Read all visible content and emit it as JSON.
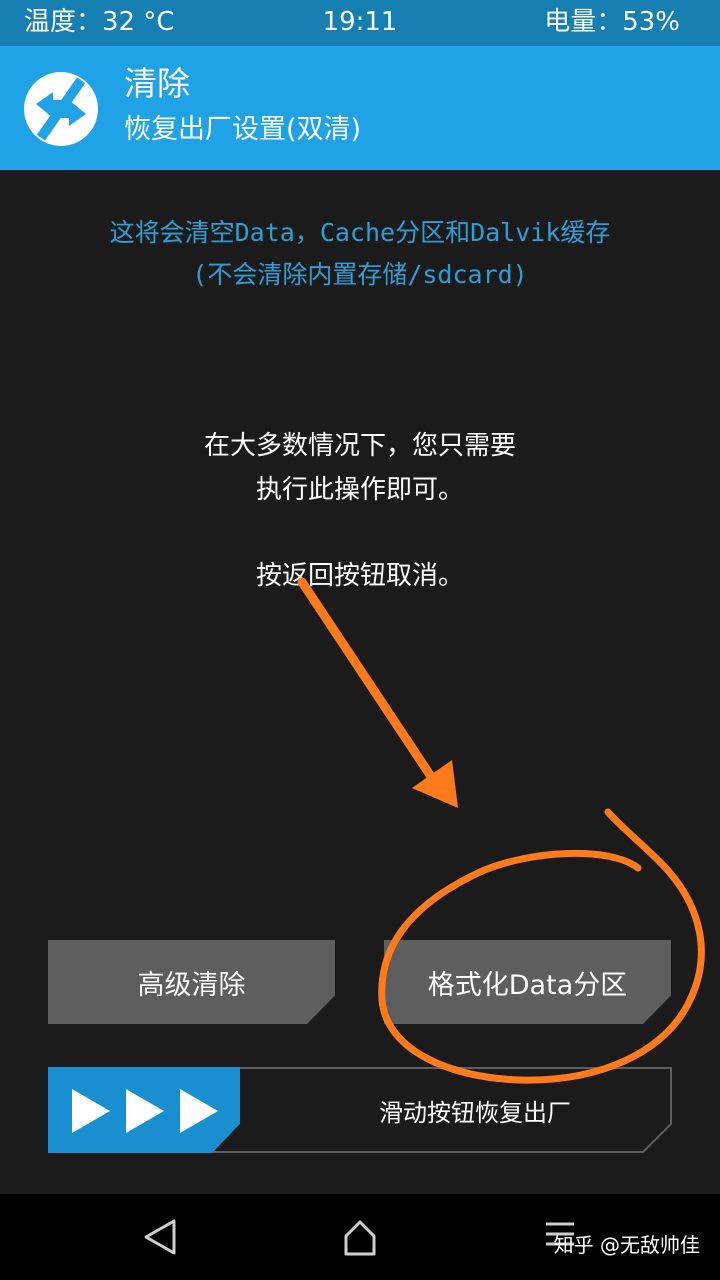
{
  "status_bar": {
    "temperature": "温度：32 °C",
    "time": "19:11",
    "battery": "电量：53%"
  },
  "header": {
    "logo_icon": "twrp-logo-icon",
    "title": "清除",
    "subtitle": "恢复出厂设置(双清)"
  },
  "notice": {
    "line1": "这将会清空Data，Cache分区和Dalvik缓存",
    "line2": "(不会清除内置存储/sdcard)"
  },
  "info": {
    "line1": "在大多数情况下，您只需要",
    "line2": "执行此操作即可。",
    "line3": "按返回按钮取消。"
  },
  "buttons": {
    "advanced_wipe": "高级清除",
    "format_data": "格式化Data分区"
  },
  "slider": {
    "icon": "triple-play-arrows-icon",
    "label": "滑动按钮恢复出厂"
  },
  "nav_bar": {
    "back_icon": "back-triangle-icon",
    "home_icon": "home-icon",
    "menu_icon": "menu-lines-icon"
  },
  "watermark": "知乎 @无敌帅佳",
  "colors": {
    "accent": "#1fa3e6",
    "status_bar": "#157fb2",
    "background": "#1b1b1b",
    "button": "#5e5e5e",
    "notice_text": "#2a9fd6",
    "annotation": "#ff7a1a"
  }
}
